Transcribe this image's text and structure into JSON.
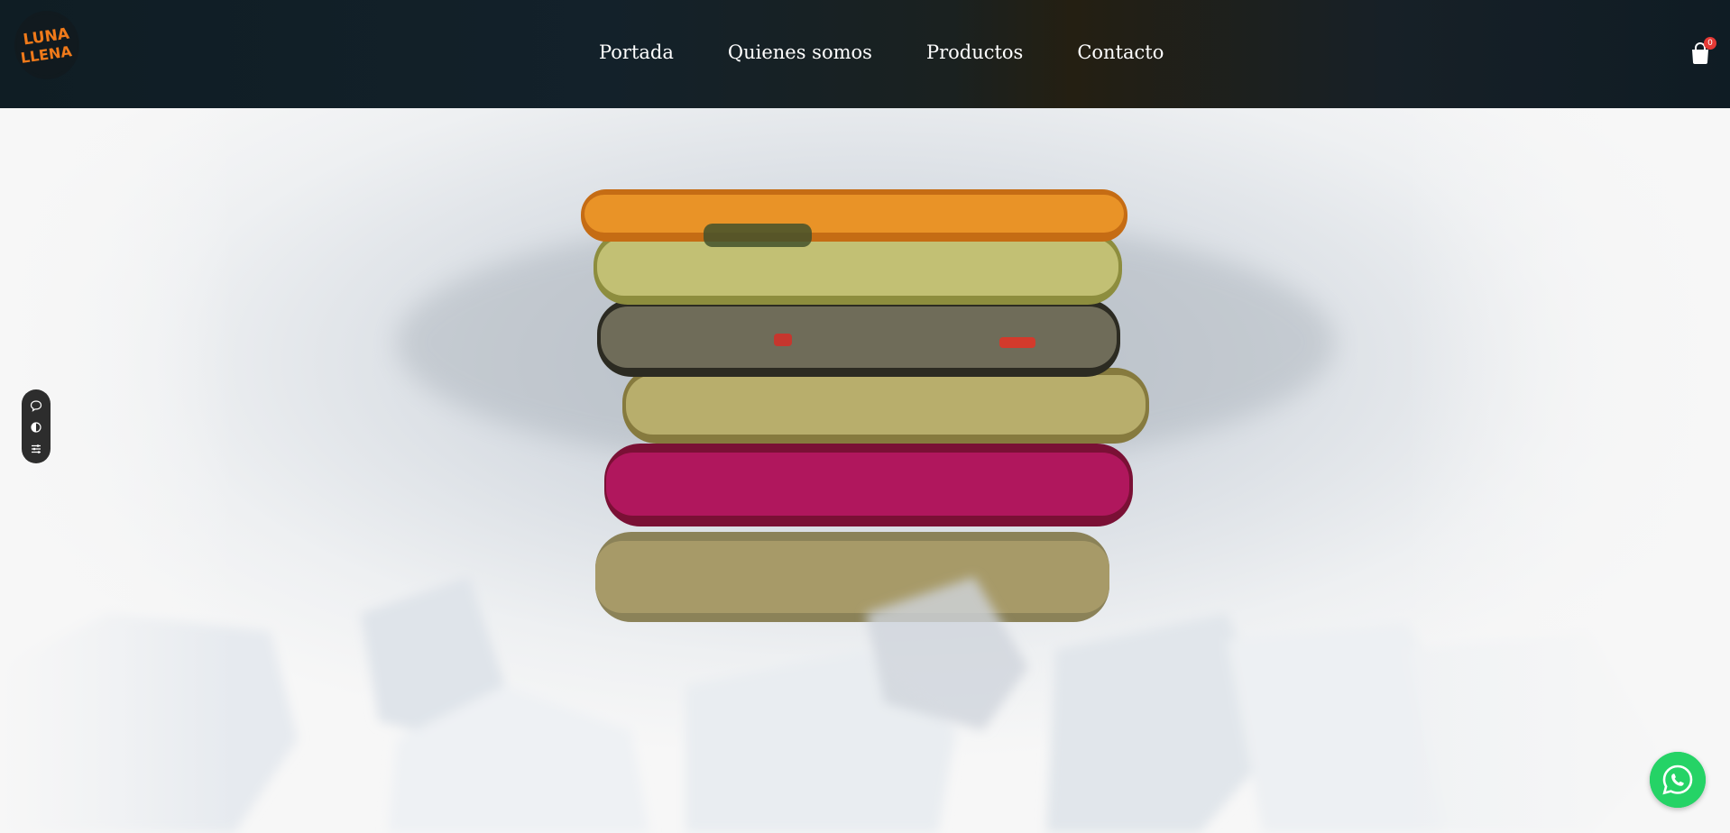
{
  "brand": {
    "logo_text_line1": "LUNA",
    "logo_text_line2": "LLENA",
    "logo_color": "#f07a1a"
  },
  "nav": {
    "items": [
      {
        "label": "Portada"
      },
      {
        "label": "Quienes somos"
      },
      {
        "label": "Productos"
      },
      {
        "label": "Contacto"
      }
    ]
  },
  "cart": {
    "icon": "shopping-bag-icon",
    "count": "0"
  },
  "hero": {
    "image": "stacked-colorful-dog-treats-on-ice-photo"
  },
  "side_widget": {
    "icons": [
      "chat-bubble-icon",
      "contrast-toggle-icon",
      "sliders-icon"
    ]
  },
  "whatsapp": {
    "icon": "whatsapp-icon",
    "color": "#25d366"
  }
}
